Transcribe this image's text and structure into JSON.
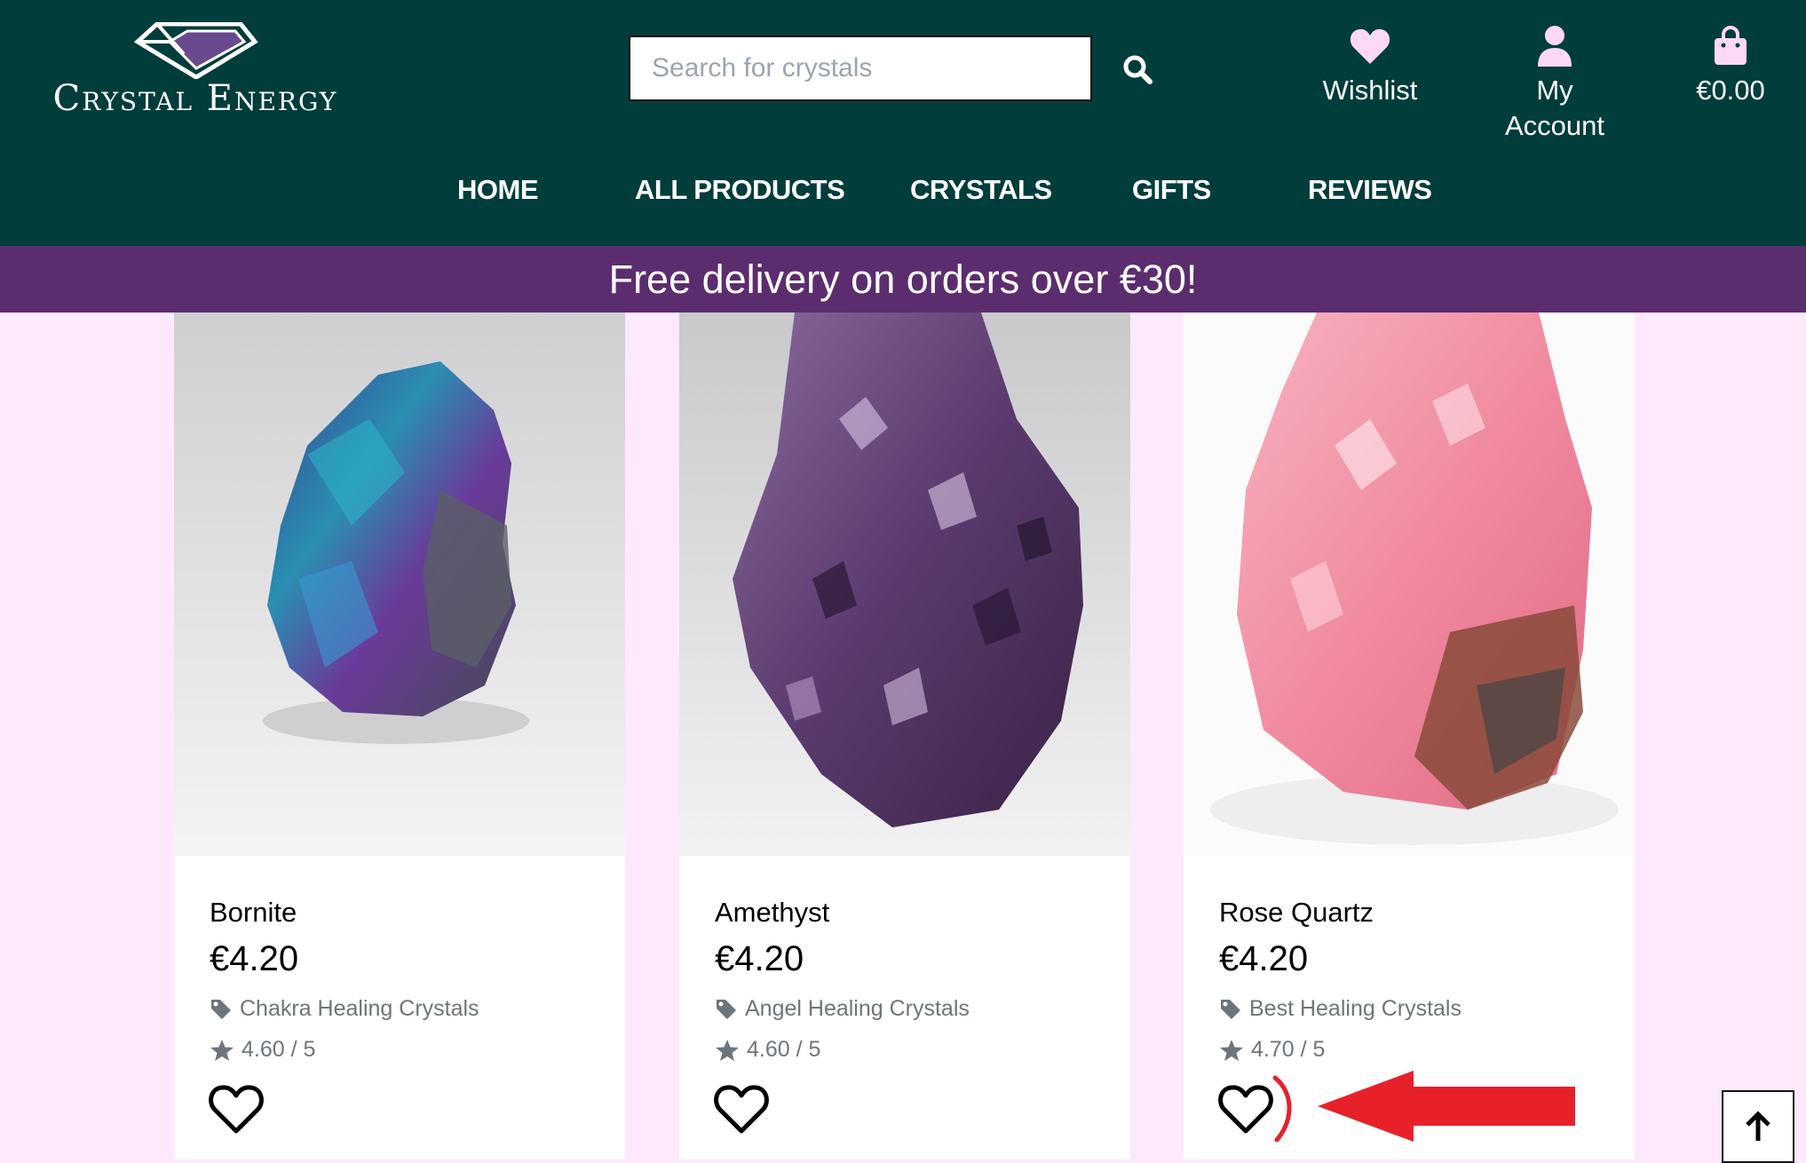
{
  "brand": {
    "name": "Crystal Energy"
  },
  "search": {
    "placeholder": "Search for crystals",
    "icon": "search-icon"
  },
  "header_links": {
    "wishlist": {
      "label": "Wishlist",
      "icon": "heart-icon"
    },
    "account": {
      "label": "My Account",
      "icon": "user-icon"
    },
    "bag": {
      "label": "€0.00",
      "icon": "shopping-bag-icon"
    }
  },
  "nav": {
    "items": [
      "HOME",
      "ALL PRODUCTS",
      "CRYSTALS",
      "GIFTS",
      "REVIEWS"
    ]
  },
  "banner": {
    "text": "Free delivery on orders over €30!"
  },
  "products": [
    {
      "name": "Bornite",
      "price": "€4.20",
      "category": "Chakra Healing Crystals",
      "rating": "4.60 / 5"
    },
    {
      "name": "Amethyst",
      "price": "€4.20",
      "category": "Angel Healing Crystals",
      "rating": "4.60 / 5"
    },
    {
      "name": "Rose Quartz",
      "price": "€4.20",
      "category": "Best Healing Crystals",
      "rating": "4.70 / 5"
    }
  ],
  "colors": {
    "header_bg": "#013d3b",
    "banner_bg": "#5c2d6e",
    "page_bg": "#fee8fb",
    "icon_pink": "#fdd8f7",
    "annotation_red": "#e8202a"
  }
}
